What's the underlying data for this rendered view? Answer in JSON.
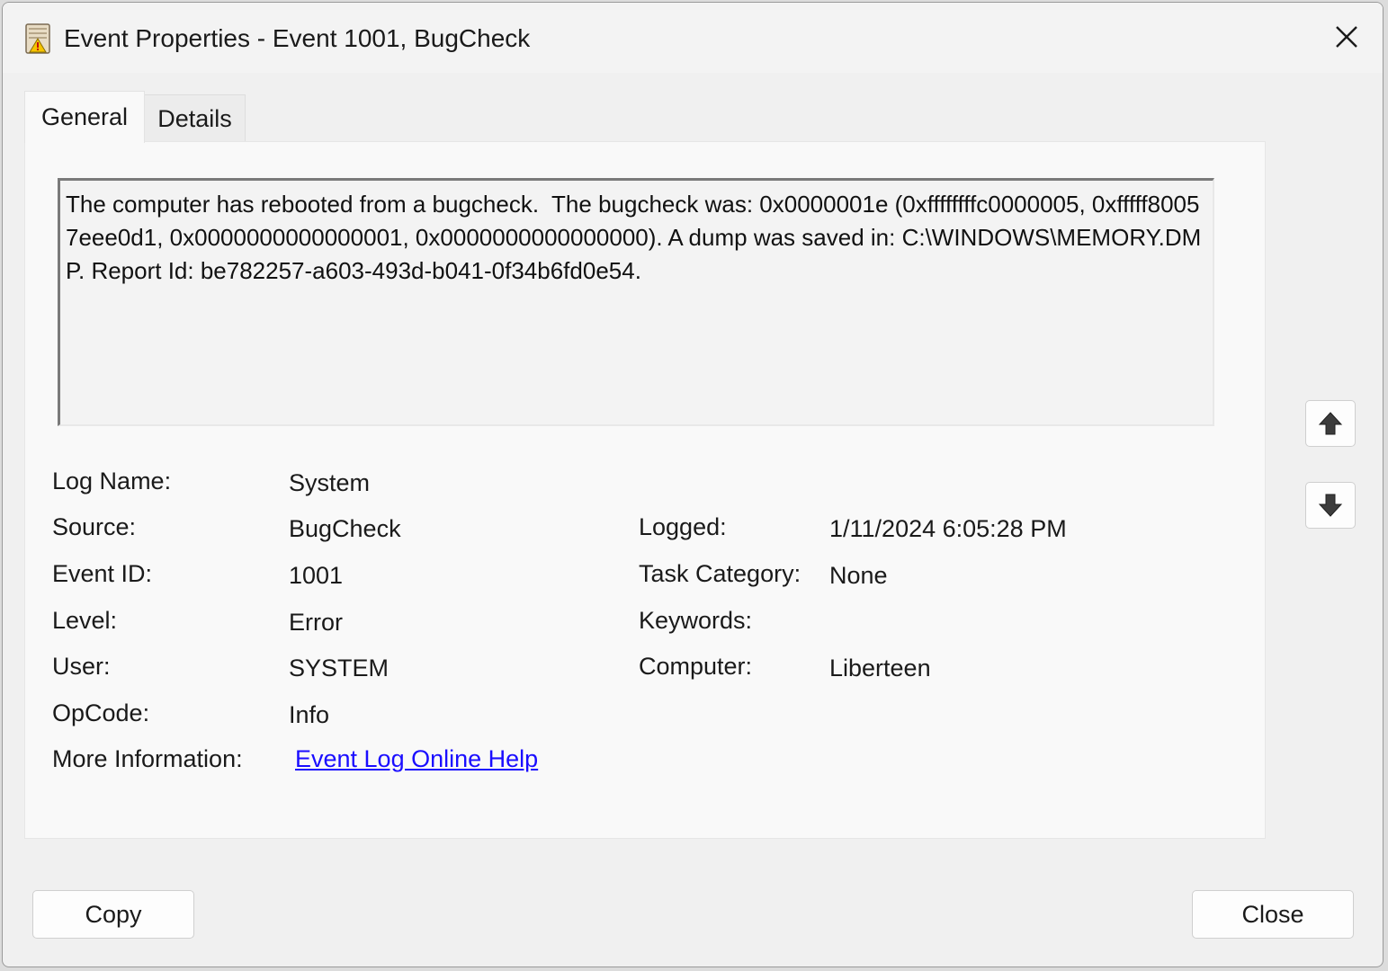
{
  "window": {
    "title": "Event Properties - Event 1001, BugCheck"
  },
  "tabs": [
    {
      "label": "General",
      "selected": true
    },
    {
      "label": "Details",
      "selected": false
    }
  ],
  "event": {
    "message": "The computer has rebooted from a bugcheck.  The bugcheck was: 0x0000001e (0xffffffffc0000005, 0xfffff80057eee0d1, 0x0000000000000001, 0x0000000000000000). A dump was saved in: C:\\WINDOWS\\MEMORY.DMP. Report Id: be782257-a603-493d-b041-0f34b6fd0e54.",
    "fields_left": [
      {
        "label": "Log Name:",
        "value": "System"
      },
      {
        "label": "Source:",
        "value": "BugCheck"
      },
      {
        "label": "Event ID:",
        "value": "1001"
      },
      {
        "label": "Level:",
        "value": "Error"
      },
      {
        "label": "User:",
        "value": "SYSTEM"
      },
      {
        "label": "OpCode:",
        "value": "Info"
      }
    ],
    "fields_right": [
      {
        "label": "Logged:",
        "value": "1/11/2024 6:05:28 PM"
      },
      {
        "label": "Task Category:",
        "value": "None"
      },
      {
        "label": "Keywords:",
        "value": ""
      },
      {
        "label": "Computer:",
        "value": "Liberteen"
      }
    ],
    "more_info": {
      "label": "More Information:",
      "link_text": "Event Log Online Help"
    }
  },
  "nav": {
    "up_icon": "arrow-up-icon",
    "down_icon": "arrow-down-icon"
  },
  "buttons": {
    "copy": "Copy",
    "close": "Close"
  },
  "colors": {
    "link": "#1a0dff",
    "window_bg": "#f0f0f0"
  }
}
